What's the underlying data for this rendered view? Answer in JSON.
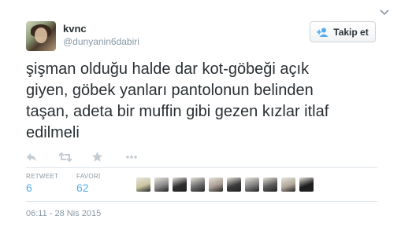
{
  "author": {
    "name": "kvnc",
    "handle": "@dunyanin6dabiri"
  },
  "follow_button": {
    "label": "Takip et"
  },
  "tweet": {
    "lines": [
      "şişman olduğu halde dar kot-göbeği açık",
      "giyen, göbek yanları pantolonun belinden",
      "taşan, adeta bir muffin gibi gezen kızlar itlaf",
      "edilmeli"
    ]
  },
  "actions": [
    "reply-icon",
    "retweet-icon",
    "favorite-icon",
    "more-icon"
  ],
  "stats": {
    "retweets": {
      "label": "RETWEET",
      "value": "6"
    },
    "favorites": {
      "label": "FAVORİ",
      "value": "62"
    }
  },
  "favoriters": [
    {
      "bg": "#c9c4a0"
    },
    {
      "bg": "#8a8a8a"
    },
    {
      "bg": "#2f2f2f"
    },
    {
      "bg": "#6d6d6d"
    },
    {
      "bg": "#a89c94"
    },
    {
      "bg": "#3c3c3c"
    },
    {
      "bg": "#7f7f7f"
    },
    {
      "bg": "#5a5a5a"
    },
    {
      "bg": "#b0a898"
    },
    {
      "bg": "#1e1e1e"
    }
  ],
  "timestamp": "06:11 - 28 Nis 2015",
  "colors": {
    "accent": "#55acee",
    "muted": "#8899a6",
    "text": "#292f33"
  }
}
